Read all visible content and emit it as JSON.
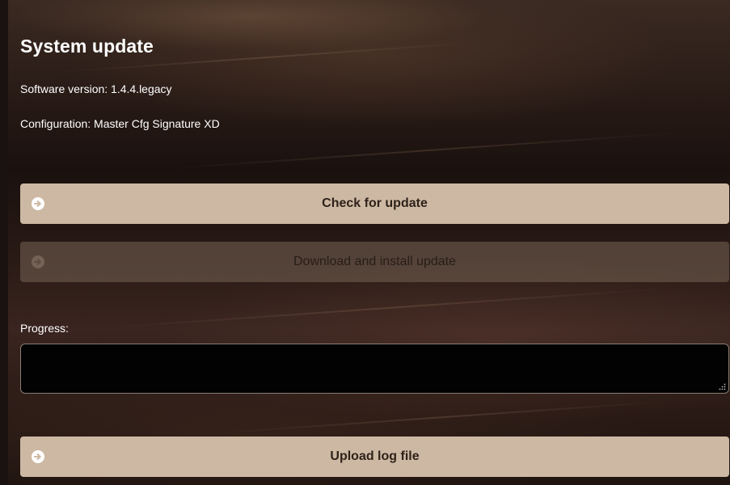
{
  "header": {
    "title": "System update"
  },
  "info": {
    "software_version": "Software version: 1.4.4.legacy",
    "configuration": "Configuration: Master Cfg Signature XD"
  },
  "buttons": {
    "check_update": {
      "label": "Check for update",
      "icon": "arrow-right-circle-icon",
      "enabled": true
    },
    "download_install": {
      "label": "Download and install update",
      "icon": "arrow-right-circle-icon",
      "enabled": false
    },
    "upload_log": {
      "label": "Upload log file",
      "icon": "arrow-right-circle-icon",
      "enabled": true
    }
  },
  "progress": {
    "label": "Progress:",
    "value_percent": 0
  },
  "colors": {
    "button_background": "#cdb8a3",
    "button_disabled_background": "#76645a",
    "button_text": "#2e2219",
    "title_text": "#ffffff",
    "progress_background": "#020202"
  }
}
